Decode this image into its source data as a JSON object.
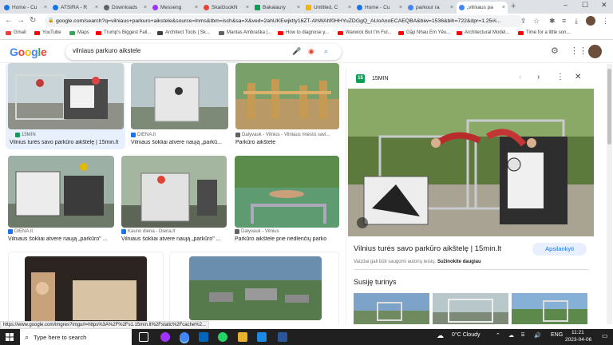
{
  "browser": {
    "tabs": [
      {
        "label": "Home - Cu",
        "color": "#1a73e8"
      },
      {
        "label": "ATSIRA - R",
        "color": "#1a73e8"
      },
      {
        "label": "Downloads",
        "color": "#5f6368"
      },
      {
        "label": "Messeng",
        "color": "#a033ff"
      },
      {
        "label": "SkaičiuokN",
        "color": "#ea4335"
      },
      {
        "label": "Bakalaury",
        "color": "#0f9d58"
      },
      {
        "label": "Untitled, C",
        "color": "#f4b400"
      },
      {
        "label": "Home - Cu",
        "color": "#1a73e8"
      },
      {
        "label": "parkour ra",
        "color": "#4285f4"
      },
      {
        "label": "„vilniaus pa",
        "color": "#4285f4"
      }
    ],
    "new_tab": "+",
    "win_min": "–",
    "win_max": "☐",
    "win_close": "✕",
    "tab_close": "×",
    "url": "google.com/search?q=vilniaus+parkuro+aikstele&source=lnms&tbm=isch&sa=X&ved=2ahUKEwjktIy16ZT-AhWAhf0HHYuZDGgQ_AUoAnoECAEQBA&biw=1536&bih=722&dpr=1.25#i...",
    "bookmarks": [
      {
        "label": "Gmail",
        "color": "#ea4335"
      },
      {
        "label": "YouTube",
        "color": "#ff0000"
      },
      {
        "label": "Maps",
        "color": "#34a853"
      },
      {
        "label": "Trump's Biggest Fail...",
        "color": "#ff0000"
      },
      {
        "label": "Architect Tools | Sk...",
        "color": "#3c4043"
      },
      {
        "label": "Mantas Ambraška |...",
        "color": "#5f6368"
      },
      {
        "label": "How to diagnose y...",
        "color": "#ff0000"
      },
      {
        "label": "Warwick But I'm Ful...",
        "color": "#ff0000"
      },
      {
        "label": "Gặp Nhau Em Yêu...",
        "color": "#ff0000"
      },
      {
        "label": "Architectural Model...",
        "color": "#ff0000"
      },
      {
        "label": "Time for a little son...",
        "color": "#ff0000"
      }
    ]
  },
  "google": {
    "logo": [
      "G",
      "o",
      "o",
      "g",
      "l",
      "e"
    ],
    "logo_colors": [
      "#4285f4",
      "#ea4335",
      "#fbbc05",
      "#4285f4",
      "#34a853",
      "#ea4335"
    ],
    "query": "vilniaus parkuro aikstele"
  },
  "results": [
    {
      "source": "15MIN",
      "title": "Vilnius turės savo parkūro aikštelę | 15min.lt",
      "icon_color": "#0f9d58"
    },
    {
      "source": "DIENA.lt",
      "title": "Vilniaus šokliai atverė naują „parkū...",
      "icon_color": "#1a73e8"
    },
    {
      "source": "Dalyvauk - Vilnius - Vilniaus miesto savi...",
      "title": "Parkūro aikštelė",
      "icon_color": "#5f6368"
    },
    {
      "source": "DIENA.lt",
      "title": "Vilniaus šokliai atverė naują „parkūro\" ...",
      "icon_color": "#1a73e8"
    },
    {
      "source": "Kauno diena - Diena.lt",
      "title": "Vilniaus šokliai atverė naują „parkūro\" ...",
      "icon_color": "#1a73e8"
    },
    {
      "source": "Dalyvauk - Vilnius",
      "title": "Parkūro aikštelė prie riedlenčių parko",
      "icon_color": "#5f6368"
    }
  ],
  "panel": {
    "source": "15MIN",
    "badge": "15",
    "title": "Vilnius turės savo parkūro aikštelę | 15min.lt",
    "visit_label": "Apsilankyti",
    "copyright": "Vaizdai gali būti saugomi autorių teisių.",
    "learn_more": "Sužinokite daugiau",
    "related_heading": "Susiję turinys"
  },
  "status_url": "https://www.google.com/imgres?imgurl=https%3A%2F%2Fs1.15min.lt%2Fstatic%2Fcache%2...",
  "taskbar": {
    "search_placeholder": "Type here to search",
    "weather": "0°C  Cloudy",
    "lang": "ENG",
    "time": "11:21",
    "date": "2023-04-06"
  }
}
